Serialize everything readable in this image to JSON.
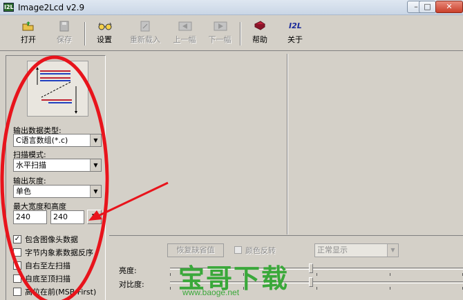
{
  "window": {
    "title": "Image2Lcd v2.9",
    "icon_text": "I2L",
    "min_symbol": "–",
    "max_symbol": "□",
    "close_symbol": "✕"
  },
  "toolbar": {
    "open": "打开",
    "save": "保存",
    "settings": "设置",
    "reload": "重新载入",
    "prev": "上一幅",
    "next": "下一幅",
    "help": "帮助",
    "about": "关于",
    "about_icon_text": "I2L"
  },
  "left_panel": {
    "output_type_label": "输出数据类型:",
    "output_type_value": "C语言数组(*.c)",
    "scan_mode_label": "扫描模式:",
    "scan_mode_value": "水平扫描",
    "gray_label": "输出灰度:",
    "gray_value": "单色",
    "max_size_label": "最大宽度和高度",
    "max_width": "240",
    "max_height": "240",
    "size_button": "▼",
    "checkboxes": [
      {
        "label": "包含图像头数据",
        "checked": true
      },
      {
        "label": "字节内象素数据反序",
        "checked": false
      },
      {
        "label": "自右至左扫描",
        "checked": false
      },
      {
        "label": "自底至顶扫描",
        "checked": false
      },
      {
        "label": "高位在前(MSB First)",
        "checked": false
      }
    ]
  },
  "bottom_panel": {
    "restore_defaults": "恢复缺省值",
    "invert_colors": "颜色反转",
    "display_mode": "正常显示",
    "brightness_label": "亮度:",
    "contrast_label": "对比度:",
    "brightness_value_pct": 48,
    "contrast_value_pct": 48
  },
  "watermark": {
    "brand": "宝哥下载",
    "url": "www.baoge.net"
  },
  "colors": {
    "annotation_red": "#e8141c",
    "watermark_green": "#3aa83a"
  }
}
